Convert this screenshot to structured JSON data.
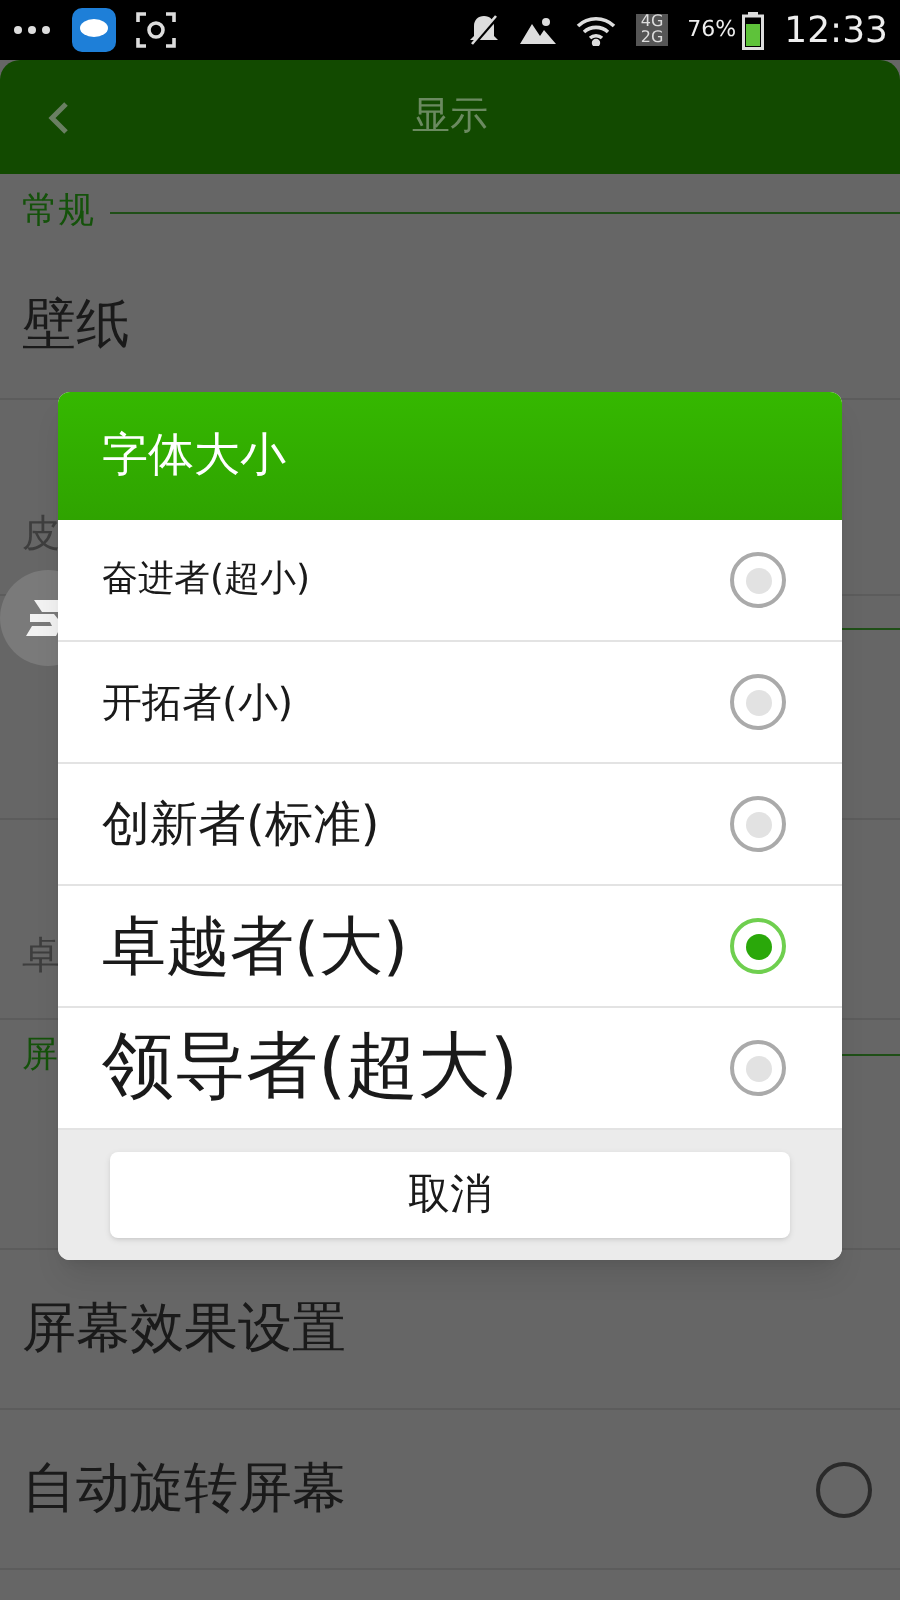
{
  "status_bar": {
    "network_top": "4G",
    "network_bottom": "2G",
    "battery": "76%",
    "time": "12:33"
  },
  "app_bar": {
    "title": "显示"
  },
  "settings": [
    {
      "kind": "section",
      "title": "常规"
    },
    {
      "kind": "item",
      "title": "壁纸"
    },
    {
      "kind": "item",
      "subtitle": "皮"
    },
    {
      "kind": "section"
    },
    {
      "kind": "item"
    },
    {
      "kind": "item",
      "subtitle": "卓"
    },
    {
      "kind": "section",
      "title": "屏"
    },
    {
      "kind": "item"
    },
    {
      "kind": "item",
      "title": "屏幕效果设置"
    },
    {
      "kind": "toggle",
      "title": "自动旋转屏幕",
      "checked": false
    }
  ],
  "dialog": {
    "title": "字体大小",
    "options": [
      {
        "label": "奋进者(超小)",
        "selected": false
      },
      {
        "label": "开拓者(小)",
        "selected": false
      },
      {
        "label": "创新者(标准)",
        "selected": false
      },
      {
        "label": "卓越者(大)",
        "selected": true
      },
      {
        "label": "领导者(超大)",
        "selected": false
      }
    ],
    "cancel": "取消"
  }
}
